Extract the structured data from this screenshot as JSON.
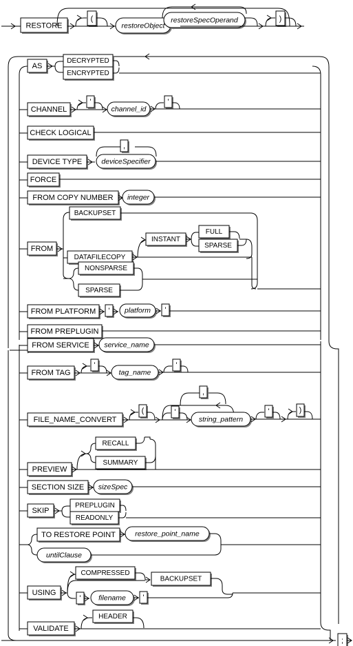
{
  "diagram": {
    "title": "RESTORE",
    "type": "railroad-syntax-diagram",
    "terminator": ";",
    "punctuation": {
      "comma": ",",
      "quote": "'",
      "lparen": "(",
      "rparen": ")",
      "semicolon": ";"
    },
    "header": {
      "start_keyword": "RESTORE",
      "lparen": "(",
      "restore_object": "restoreObject",
      "restore_spec_operand": "restoreSpecOperand",
      "rparen": ")"
    },
    "options": [
      {
        "id": "as",
        "keyword": "AS",
        "alts": [
          "DECRYPTED",
          "ENCRYPTED"
        ]
      },
      {
        "id": "channel",
        "keyword": "CHANNEL",
        "nonterm": "channel_id"
      },
      {
        "id": "check-logical",
        "keyword": "CHECK LOGICAL"
      },
      {
        "id": "device-type",
        "keyword": "DEVICE TYPE",
        "nonterm": "deviceSpecifier"
      },
      {
        "id": "force",
        "keyword": "FORCE"
      },
      {
        "id": "from-copy-number",
        "keyword": "FROM COPY NUMBER",
        "nonterm": "integer"
      },
      {
        "id": "from",
        "keyword": "FROM",
        "alts": [
          "BACKUPSET",
          "DATAFILECOPY",
          "NONSPARSE",
          "SPARSE"
        ],
        "sub": {
          "keyword": "INSTANT",
          "alts": [
            "FULL",
            "SPARSE"
          ]
        }
      },
      {
        "id": "from-platform",
        "keyword": "FROM PLATFORM",
        "nonterm": "platform"
      },
      {
        "id": "from-preplugin",
        "keyword": "FROM PREPLUGIN"
      },
      {
        "id": "from-service",
        "keyword": "FROM SERVICE",
        "nonterm": "service_name"
      },
      {
        "id": "from-tag",
        "keyword": "FROM TAG",
        "nonterm": "tag_name"
      },
      {
        "id": "file-name-convert",
        "keyword": "FILE_NAME_CONVERT",
        "nonterm": "string_pattern"
      },
      {
        "id": "preview",
        "keyword": "PREVIEW",
        "alts": [
          "RECALL",
          "SUMMARY"
        ]
      },
      {
        "id": "section-size",
        "keyword": "SECTION SIZE",
        "nonterm": "sizeSpec"
      },
      {
        "id": "skip",
        "keyword": "SKIP",
        "alts": [
          "PREPLUGIN",
          "READONLY"
        ]
      },
      {
        "id": "to-restore-point",
        "keyword": "TO RESTORE POINT",
        "nonterm": "restore_point_name"
      },
      {
        "id": "until-clause",
        "nonterm": "untilClause"
      },
      {
        "id": "using",
        "keyword": "USING",
        "alts": [
          "COMPRESSED",
          "BACKUPSET"
        ],
        "nonterm": "filename"
      },
      {
        "id": "validate",
        "keyword": "VALIDATE",
        "alts": [
          "HEADER"
        ]
      }
    ]
  }
}
